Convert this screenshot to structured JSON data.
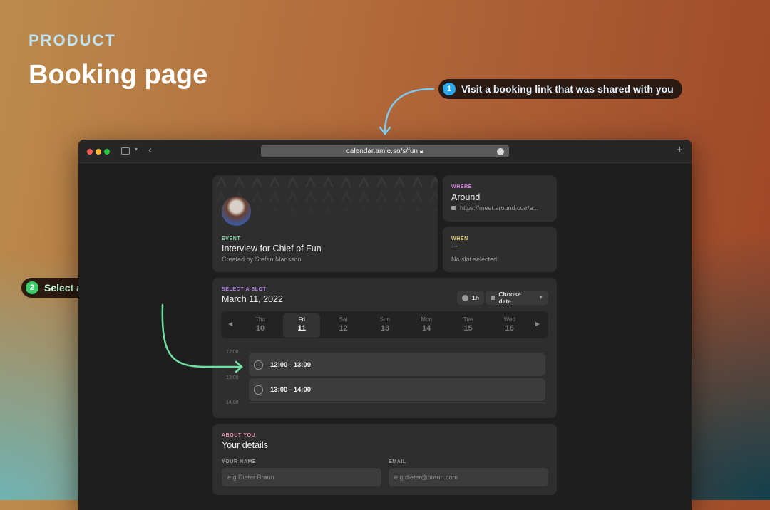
{
  "header": {
    "eyebrow": "PRODUCT",
    "title": "Booking page"
  },
  "annotations": [
    {
      "number": "1",
      "text": "Visit a booking link that was shared with you",
      "color": "#2aa8f0"
    },
    {
      "number": "2",
      "text": "Select any free slot to book it",
      "color": "#3dcc6a"
    }
  ],
  "browser": {
    "url": "calendar.amie.so/s/fun"
  },
  "event": {
    "label": "EVENT",
    "title": "Interview for Chief of Fun",
    "creator": "Created by Stefan Mansson"
  },
  "where": {
    "label": "WHERE",
    "title": "Around",
    "link": "https://meet.around.co/r/a..."
  },
  "when": {
    "label": "WHEN",
    "dash": "—",
    "status": "No slot selected"
  },
  "slots": {
    "label": "SELECT A SLOT",
    "date": "March 11, 2022",
    "duration": "1h",
    "choose_date": "Choose date",
    "days": [
      {
        "w": "Thu",
        "n": "10"
      },
      {
        "w": "Fri",
        "n": "11"
      },
      {
        "w": "Sat",
        "n": "12"
      },
      {
        "w": "Sun",
        "n": "13"
      },
      {
        "w": "Mon",
        "n": "14"
      },
      {
        "w": "Tue",
        "n": "15"
      },
      {
        "w": "Wed",
        "n": "16"
      }
    ],
    "selected_day": "Fri 11",
    "times": [
      "12:00",
      "13:00",
      "14:00"
    ],
    "options": [
      "12:00 - 13:00",
      "13:00 - 14:00"
    ]
  },
  "about": {
    "label": "ABOUT YOU",
    "title": "Your details",
    "name_label": "YOUR NAME",
    "name_placeholder": "e.g Dieter Braun",
    "email_label": "EMAIL",
    "email_placeholder": "e.g dieter@braun.com"
  }
}
